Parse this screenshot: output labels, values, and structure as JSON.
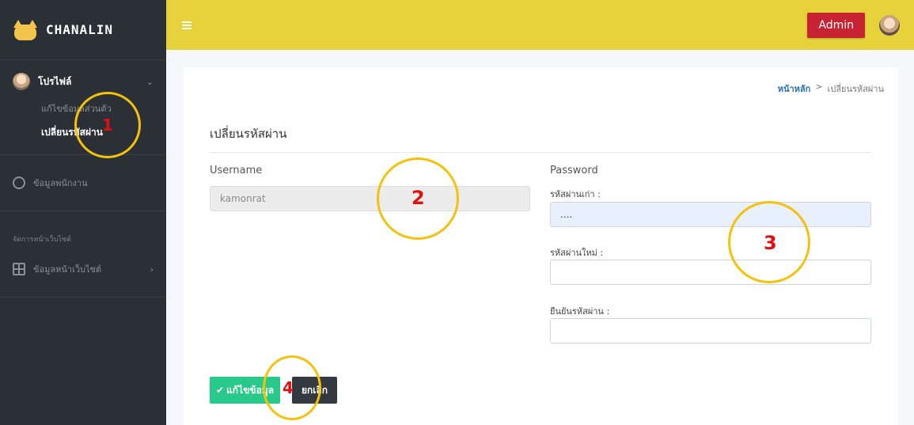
{
  "brand": {
    "name": "CHANALIN"
  },
  "sidebar": {
    "profile_label": "โปรไฟล์",
    "sub_items": [
      "แก้ไขข้อมูลส่วนตัว",
      "เปลี่ยนรหัสผ่าน"
    ],
    "employee_label": "ข้อมูลพนักงาน",
    "section_title": "จัดการหน้าเว็บไซต์",
    "website_label": "ข้อมูลหน้าเว็บไซต์"
  },
  "topbar": {
    "admin_label": "Admin"
  },
  "breadcrumb": {
    "home": "หน้าหลัก",
    "separator": ">",
    "current": "เปลี่ยนรหัสผ่าน"
  },
  "page": {
    "title": "เปลี่ยนรหัสผ่าน"
  },
  "form": {
    "username_label": "Username",
    "username_value": "kamonrat",
    "password_label": "Password",
    "old_password_label": "รหัสผ่านเก่า :",
    "old_password_value": "....",
    "new_password_label": "รหัสผ่านใหม่ :",
    "new_password_value": "",
    "confirm_password_label": "ยืนยันรหัสผ่าน :",
    "confirm_password_value": ""
  },
  "buttons": {
    "save_label": "แก้ไขข้อมูล",
    "cancel_label": "ยกเลิก",
    "save_icon": "✔"
  },
  "annotations": [
    "1",
    "2",
    "3",
    "4"
  ],
  "colors": {
    "topbar": "#e6d23a",
    "sidebar": "#2b2f36",
    "admin_button": "#c82333",
    "save_button": "#28c98a",
    "cancel_button": "#343a40",
    "annotation_circle": "#f4c20d",
    "annotation_number": "#e01010"
  }
}
